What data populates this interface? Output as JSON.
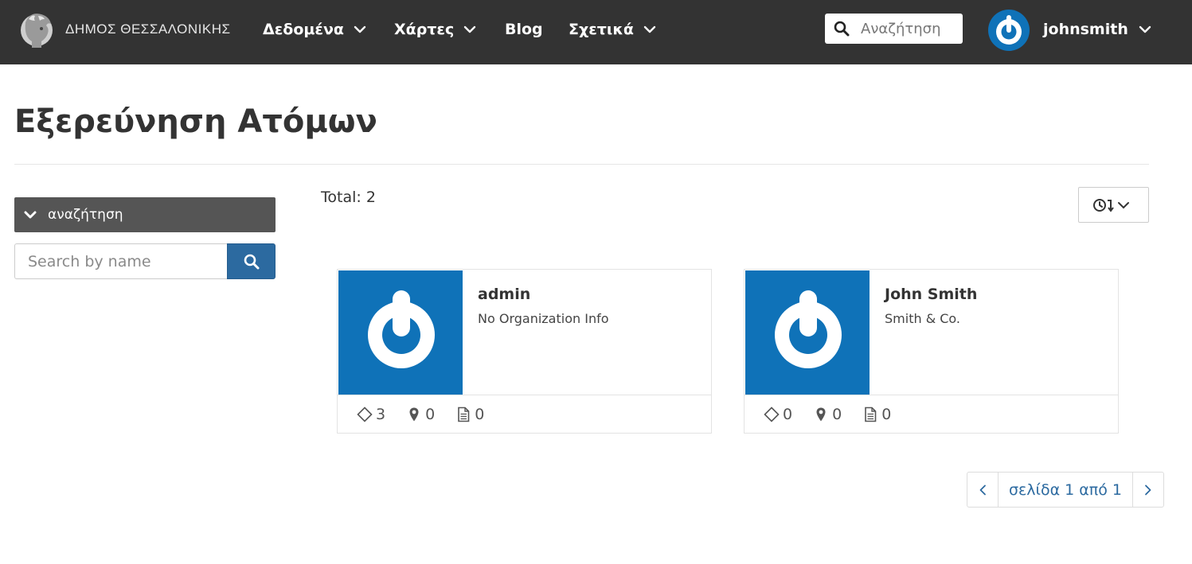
{
  "header": {
    "brand_text": "ΔΗΜΟΣ ΘΕΣΣΑΛΟΝΙΚΗΣ",
    "nav": [
      {
        "label": "Δεδομένα",
        "has_dropdown": true
      },
      {
        "label": "Χάρτες",
        "has_dropdown": true
      },
      {
        "label": "Blog",
        "has_dropdown": false
      },
      {
        "label": "Σχετικά",
        "has_dropdown": true
      }
    ],
    "search_placeholder": "Αναζήτηση",
    "username": "johnsmith"
  },
  "page": {
    "title": "Εξερεύνηση Ατόμων"
  },
  "sidebar": {
    "filter_label": "αναζήτηση",
    "name_search_placeholder": "Search by name"
  },
  "results": {
    "total_label": "Total: 2",
    "people": [
      {
        "name": "admin",
        "organization": "No Organization Info",
        "resources": "3",
        "maps": "0",
        "documents": "0"
      },
      {
        "name": "John Smith",
        "organization": "Smith & Co.",
        "resources": "0",
        "maps": "0",
        "documents": "0"
      }
    ]
  },
  "pagination": {
    "label": "σελίδα 1 από 1"
  },
  "colors": {
    "navbar": "#333333",
    "accent_blue": "#2c6aa0",
    "avatar_blue": "#0f72b8",
    "filter_header": "#555555"
  },
  "icons": {
    "search": "search-icon",
    "chevron": "chevron-down-icon",
    "sort": "clock-sort-icon",
    "resource": "diamond-icon",
    "map": "map-marker-icon",
    "document": "document-icon"
  }
}
